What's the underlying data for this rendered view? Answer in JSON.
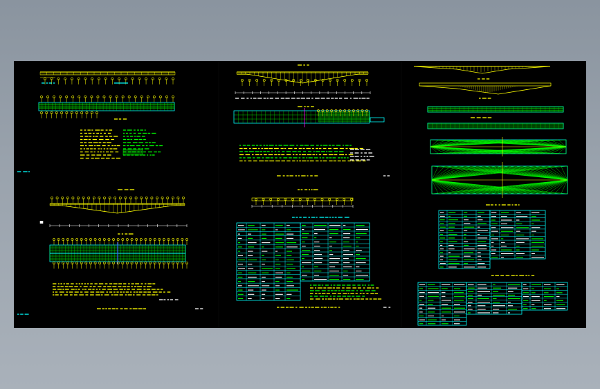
{
  "colors": {
    "background": "#000000",
    "frame_bg_top": "#8a949f",
    "frame_bg_bottom": "#a9b1ba",
    "yellow": "#ffff00",
    "green": "#00ff00",
    "cyan": "#00ffff",
    "white": "#ffffff",
    "blue": "#3c5cff",
    "magenta": "#ff00ff"
  },
  "drawing": {
    "sheets": [
      {
        "name": "sheet-1",
        "label_bottom_left": "",
        "label_bottom_right": ""
      },
      {
        "name": "sheet-2",
        "label_bottom_left": "",
        "label_bottom_right": ""
      },
      {
        "name": "sheet-3",
        "label_bottom_left": "",
        "label_bottom_right": ""
      }
    ]
  }
}
